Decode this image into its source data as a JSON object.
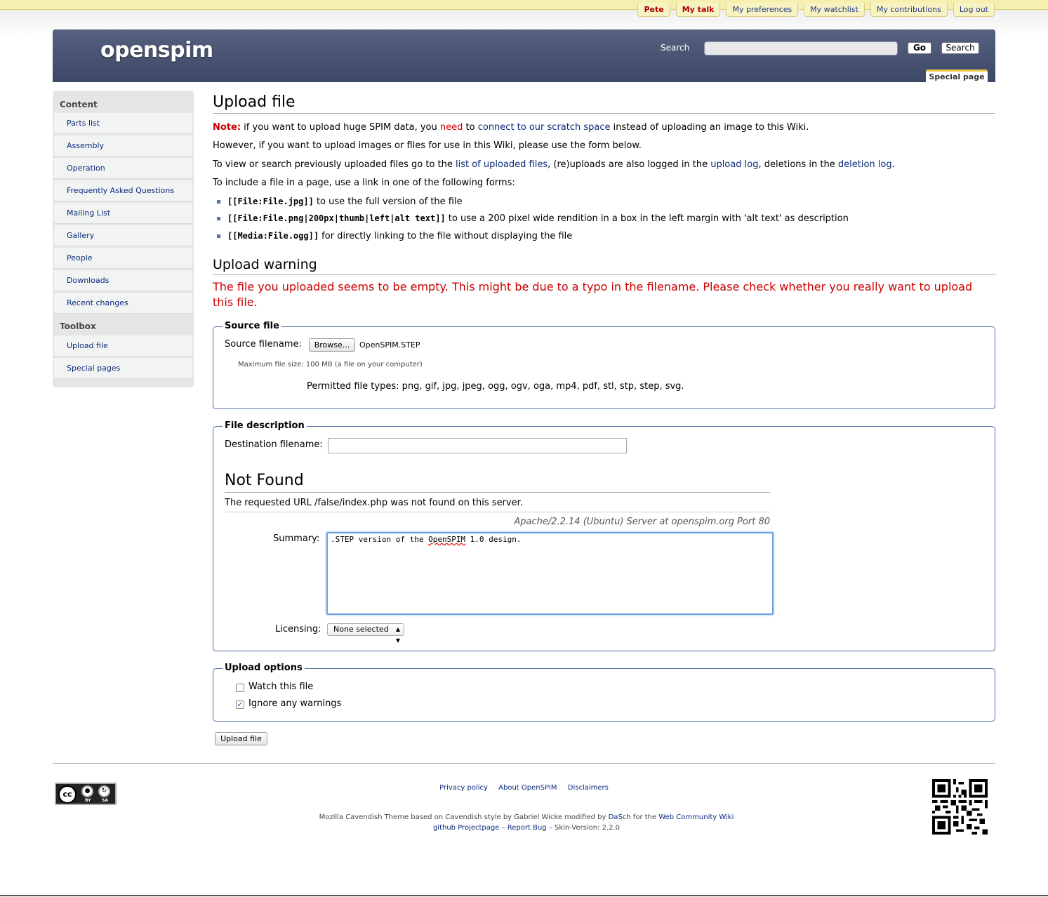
{
  "personal": [
    "Pete",
    "My talk",
    "My preferences",
    "My watchlist",
    "My contributions",
    "Log out"
  ],
  "header": {
    "logo": "openspim",
    "search_label": "Search",
    "go_label": "Go",
    "search_button": "Search",
    "tab": "Special page"
  },
  "sidebar": {
    "content_title": "Content",
    "content_items": [
      "Parts list",
      "Assembly",
      "Operation",
      "Frequently Asked Questions",
      "Mailing List",
      "Gallery",
      "People",
      "Downloads",
      "Recent changes"
    ],
    "toolbox_title": "Toolbox",
    "toolbox_items": [
      "Upload file",
      "Special pages"
    ]
  },
  "main": {
    "title": "Upload file",
    "note_label": "Note:",
    "note_text1": " if you want to upload huge SPIM data, you ",
    "note_need": "need",
    "note_text2": " to ",
    "note_link": "connect to our scratch space",
    "note_text3": " instead of uploading an image to this Wiki.",
    "however": "However, if you want to upload images or files for use in this Wiki, please use the form below.",
    "view_text1": "To view or search previously uploaded files go to the ",
    "view_link1": "list of uploaded files",
    "view_text2": ", (re)uploads are also logged in the ",
    "view_link2": "upload log",
    "view_text3": ", deletions in the ",
    "view_link3": "deletion log",
    "view_text4": ".",
    "include_text": "To include a file in a page, use a link in one of the following forms:",
    "forms": [
      {
        "code": "[[File:File.jpg]]",
        "text": " to use the full version of the file"
      },
      {
        "code": "[[File:File.png|200px|thumb|left|alt text]]",
        "text": " to use a 200 pixel wide rendition in a box in the left margin with 'alt text' as description"
      },
      {
        "code": "[[Media:File.ogg]]",
        "text": " for directly linking to the file without displaying the file"
      }
    ],
    "warning_title": "Upload warning",
    "warning_text": "The file you uploaded seems to be empty. This might be due to a typo in the filename. Please check whether you really want to upload this file."
  },
  "source": {
    "legend": "Source file",
    "filename_label": "Source filename:",
    "browse": "Browse...",
    "filename": "OpenSPIM.STEP",
    "max_size": "Maximum file size: 100 MB (a file on your computer)",
    "permitted": "Permitted file types: png, gif, jpg, jpeg, ogg, ogv, oga, mp4, pdf, stl, stp, step, svg."
  },
  "description": {
    "legend": "File description",
    "dest_label": "Destination filename:",
    "dest_value": "",
    "nf_title": "Not Found",
    "nf_text": "The requested URL /false/index.php was not found on this server.",
    "nf_server": "Apache/2.2.14 (Ubuntu) Server at openspim.org Port 80",
    "summary_label": "Summary:",
    "summary_pre": ".STEP version of the ",
    "summary_spell": "OpenSPIM",
    "summary_post": " 1.0 design.",
    "licensing_label": "Licensing:",
    "licensing_value": "None selected"
  },
  "options": {
    "legend": "Upload options",
    "watch_label": "Watch this file",
    "watch_checked": false,
    "ignore_label": "Ignore any warnings",
    "ignore_checked": true
  },
  "upload_button": "Upload file",
  "footer": {
    "links": [
      "Privacy policy",
      "About OpenSPIM",
      "Disclaimers"
    ],
    "credit1_a": "Mozilla Cavendish Theme based on Cavendish style by Gabriel Wicke modified by ",
    "credit1_link1": "DaSch",
    "credit1_b": " for the ",
    "credit1_link2": "Web Community Wiki",
    "credit2_link1": "github Projectpage",
    "credit2_sep": " – ",
    "credit2_link2": "Report Bug",
    "credit2_c": " – Skin-Version: 2.2.0",
    "cc_by": "BY",
    "cc_sa": "SA"
  }
}
